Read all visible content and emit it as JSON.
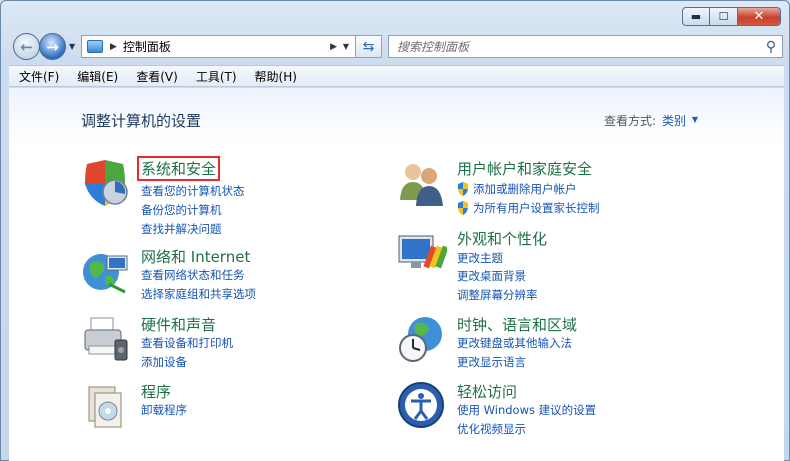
{
  "window": {
    "controls": {
      "minimize": "▬",
      "maximize": "☐",
      "close": "✕"
    }
  },
  "nav": {
    "address": "控制面板",
    "search_placeholder": "搜索控制面板"
  },
  "menu": [
    "文件(F)",
    "编辑(E)",
    "查看(V)",
    "工具(T)",
    "帮助(H)"
  ],
  "page": {
    "title": "调整计算机的设置",
    "view_by_label": "查看方式:",
    "view_by_value": "类别"
  },
  "categories": [
    {
      "title": "系统和安全",
      "links": [
        "查看您的计算机状态",
        "备份您的计算机",
        "查找并解决问题"
      ]
    },
    {
      "title": "网络和 Internet",
      "links": [
        "查看网络状态和任务",
        "选择家庭组和共享选项"
      ]
    },
    {
      "title": "硬件和声音",
      "links": [
        "查看设备和打印机",
        "添加设备"
      ]
    },
    {
      "title": "程序",
      "links": [
        "卸载程序"
      ]
    },
    {
      "title": "用户帐户和家庭安全",
      "links": [
        "添加或删除用户帐户",
        "为所有用户设置家长控制"
      ]
    },
    {
      "title": "外观和个性化",
      "links": [
        "更改主题",
        "更改桌面背景",
        "调整屏幕分辨率"
      ]
    },
    {
      "title": "时钟、语言和区域",
      "links": [
        "更改键盘或其他输入法",
        "更改显示语言"
      ]
    },
    {
      "title": "轻松访问",
      "links": [
        "使用 Windows 建议的设置",
        "优化视频显示"
      ]
    }
  ],
  "colors": {
    "category_title": "#1e7145",
    "link": "#1555b5",
    "highlight_box": "#e52b2b"
  }
}
